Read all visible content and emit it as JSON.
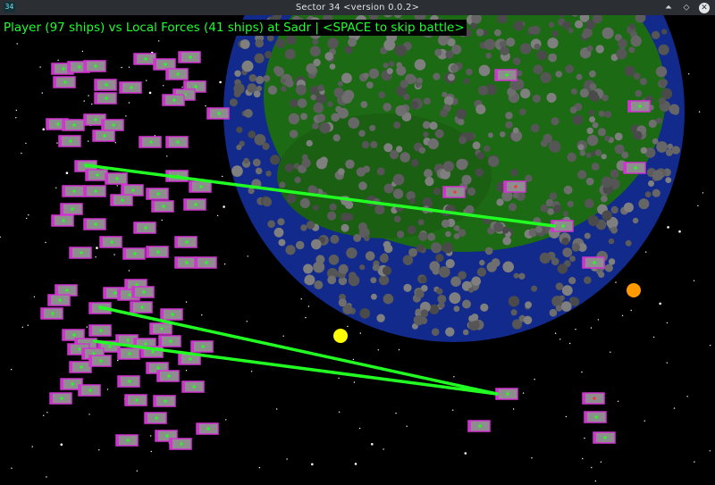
{
  "window": {
    "app_icon_text": "34",
    "title": "Sector 34    <version 0.0.2>",
    "buttons": {
      "minimize": "⏶",
      "maximize": "⬦",
      "close": "✕"
    }
  },
  "status_line": "Player (97 ships) vs Local Forces (41 ships) at Sadr  | <SPACE to skip battle>",
  "battle": {
    "player_ships": 97,
    "enemy_ships": 41,
    "location": "Sadr",
    "skip_key": "SPACE"
  },
  "colors": {
    "background": "#000000",
    "status_text": "#1dff2e",
    "laser": "#22ff22",
    "ship_fill": "#8e8e8e",
    "ship_border": "#d233d2",
    "ship_dot_player": "#22ff22",
    "ship_dot_enemy": "#ff3333",
    "planet_ocean": "#122a8c",
    "planet_land": "#1c6b14",
    "planet_rock": "#5a5a5a",
    "sun_yellow": "#ffff00",
    "sun_orange": "#ff9900"
  },
  "icons": [
    "app-icon",
    "minimize-icon",
    "maximize-icon",
    "close-icon"
  ]
}
